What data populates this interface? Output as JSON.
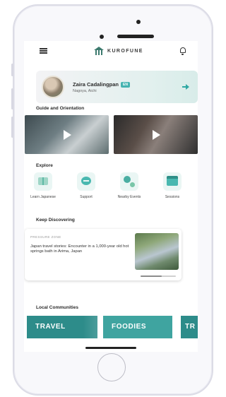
{
  "header": {
    "logo_text": "KUROFUNE"
  },
  "profile": {
    "name": "Zaira Cadalingpan",
    "badge": "EN",
    "location": "Nagoya, Aichi"
  },
  "guide": {
    "title": "Guide and Orientation",
    "videos": [
      {
        "label": "video-1"
      },
      {
        "label": "video-2"
      }
    ]
  },
  "explore": {
    "title": "Explore",
    "items": [
      {
        "label": "Learn Japanese",
        "icon": "book-icon"
      },
      {
        "label": "Support",
        "icon": "chat-icon"
      },
      {
        "label": "Nearby Events",
        "icon": "location-icon"
      },
      {
        "label": "Sessions",
        "icon": "calendar-icon"
      }
    ]
  },
  "discover": {
    "title": "Keep Discovering",
    "card": {
      "tag": "PRESSURE ZONE",
      "text": "Japan travel stories: Encounter in a 1,000-year old hot springs bath in Arima, Japan"
    }
  },
  "communities": {
    "title": "Local Communities",
    "chips": [
      "TRAVEL",
      "FOODIES",
      "TR"
    ]
  },
  "colors": {
    "accent": "#2fa8a3",
    "chip_dark": "#2d8c8a",
    "chip_light": "#3fa4a0"
  }
}
